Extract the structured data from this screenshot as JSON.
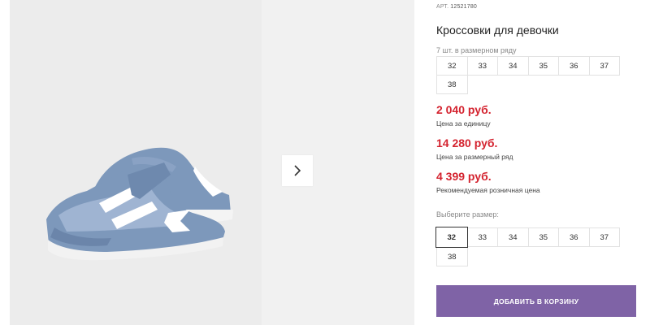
{
  "product": {
    "article_label": "АРТ.",
    "article_number": "12521780",
    "title": "Кроссовки для девочки",
    "size_row_note": "7 шт. в размерном ряду"
  },
  "size_row": [
    "32",
    "33",
    "34",
    "35",
    "36",
    "37",
    "38"
  ],
  "prices": [
    {
      "amount": "2 040 руб.",
      "caption": "Цена за единицу"
    },
    {
      "amount": "14 280 руб.",
      "caption": "Цена за размерный ряд"
    },
    {
      "amount": "4 399 руб.",
      "caption": "Рекомендуемая розничная цена"
    }
  ],
  "size_picker": {
    "label": "Выберите размер:",
    "options": [
      "32",
      "33",
      "34",
      "35",
      "36",
      "37",
      "38"
    ],
    "selected": "32"
  },
  "cart": {
    "add_label": "ДОБАВИТЬ В КОРЗИНУ"
  },
  "icons": {
    "next": "chevron-right-icon"
  },
  "colors": {
    "price": "#d4232f",
    "accent_button": "#7f63a6"
  }
}
